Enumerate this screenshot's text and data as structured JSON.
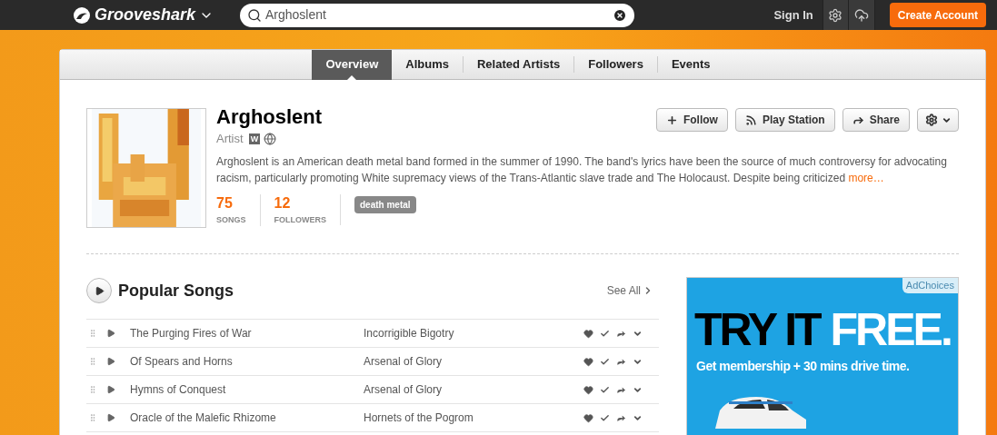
{
  "topbar": {
    "logo": "Grooveshark",
    "search": {
      "value": "Arghoslent"
    },
    "sign_in": "Sign In",
    "create_account": "Create Account"
  },
  "tabs": [
    {
      "label": "Overview",
      "selected": true
    },
    {
      "label": "Albums",
      "selected": false
    },
    {
      "label": "Related Artists",
      "selected": false
    },
    {
      "label": "Followers",
      "selected": false
    },
    {
      "label": "Events",
      "selected": false
    }
  ],
  "artist": {
    "name": "Arghoslent",
    "type": "Artist",
    "wiki_badge": "W",
    "description": "Arghoslent is an American death metal band formed in the summer of 1990. The band's lyrics have been the source of much controversy for advocating racism, particularly promoting White supremacy views of the Trans-Atlantic slave trade and The Holocaust. Despite being criticized",
    "more_link": "more…",
    "stats": [
      {
        "value": "75",
        "label": "SONGS"
      },
      {
        "value": "12",
        "label": "FOLLOWERS"
      }
    ],
    "tags": [
      "death metal"
    ],
    "buttons": [
      "Follow",
      "Play Station",
      "Share"
    ]
  },
  "popular_songs": {
    "title": "Popular Songs",
    "see_all": "See All",
    "rows": [
      {
        "song": "The Purging Fires of War",
        "album": "Incorrigible Bigotry"
      },
      {
        "song": "Of Spears and Horns",
        "album": "Arsenal of Glory"
      },
      {
        "song": "Hymns of Conquest",
        "album": "Arsenal of Glory"
      },
      {
        "song": "Oracle of the Malefic Rhizome",
        "album": "Hornets of the Pogrom"
      }
    ]
  },
  "ad": {
    "adchoices": "AdChoices",
    "headline_dark": "TRY IT",
    "headline_light": "FREE.",
    "subline": "Get membership + 30 mins drive time."
  }
}
